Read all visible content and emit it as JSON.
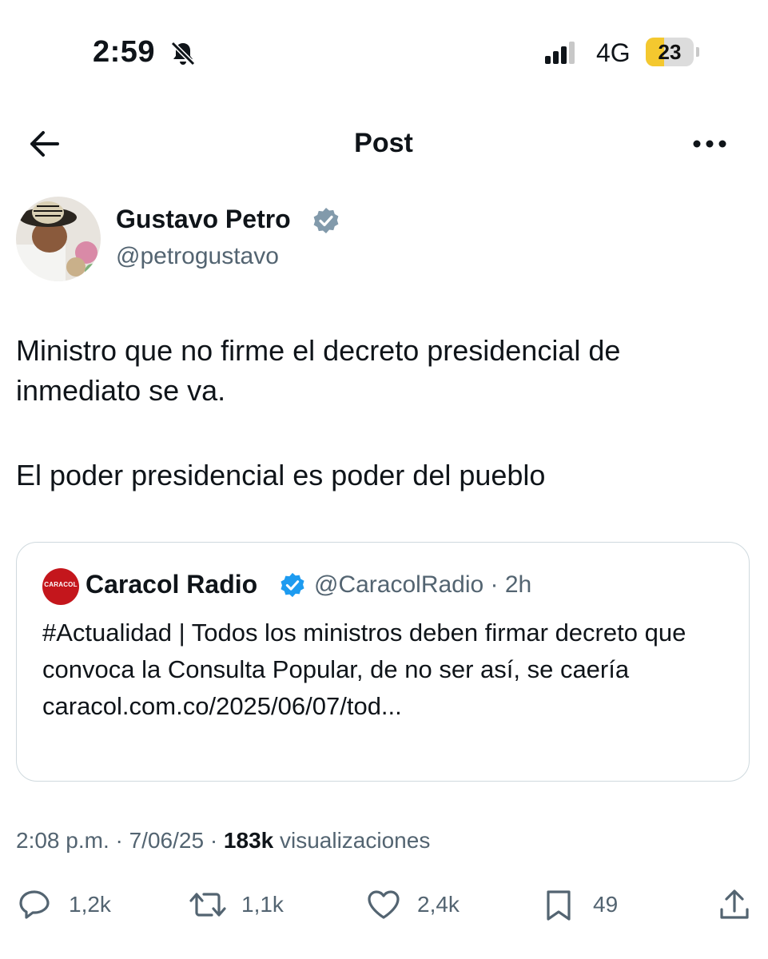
{
  "status_bar": {
    "time": "2:59",
    "network": "4G",
    "battery": "23",
    "battery_level": 0.23,
    "accent_color": "#f4c82f"
  },
  "nav": {
    "title": "Post"
  },
  "author": {
    "name": "Gustavo Petro",
    "handle": "@petrogustavo"
  },
  "tweet": {
    "line1": "Ministro que no firme el decreto presidencial de inmediato se va.",
    "line2": "El poder presidencial es poder del pueblo"
  },
  "quote": {
    "avatar_text": "CARACOL",
    "name": "Caracol Radio",
    "handle_time": "@CaracolRadio · 2h",
    "text": "#Actualidad | Todos los ministros deben firmar decreto que convoca la Consulta Popular, de no ser así, se caería",
    "link": "caracol.com.co/2025/06/07/tod..."
  },
  "meta": {
    "datetime": "2:08 p.m. · 7/06/25 · ",
    "views_count": "183k",
    "views_label": " visualizaciones"
  },
  "actions": {
    "replies": "1,2k",
    "reposts": "1,1k",
    "likes": "2,4k",
    "bookmarks": "49"
  },
  "colors": {
    "text": "#0f1419",
    "secondary": "#536471",
    "verified": "#1d9bf0",
    "verified_gray": "#829aab",
    "border": "#cfd9de",
    "caracol_red": "#c4161c"
  }
}
